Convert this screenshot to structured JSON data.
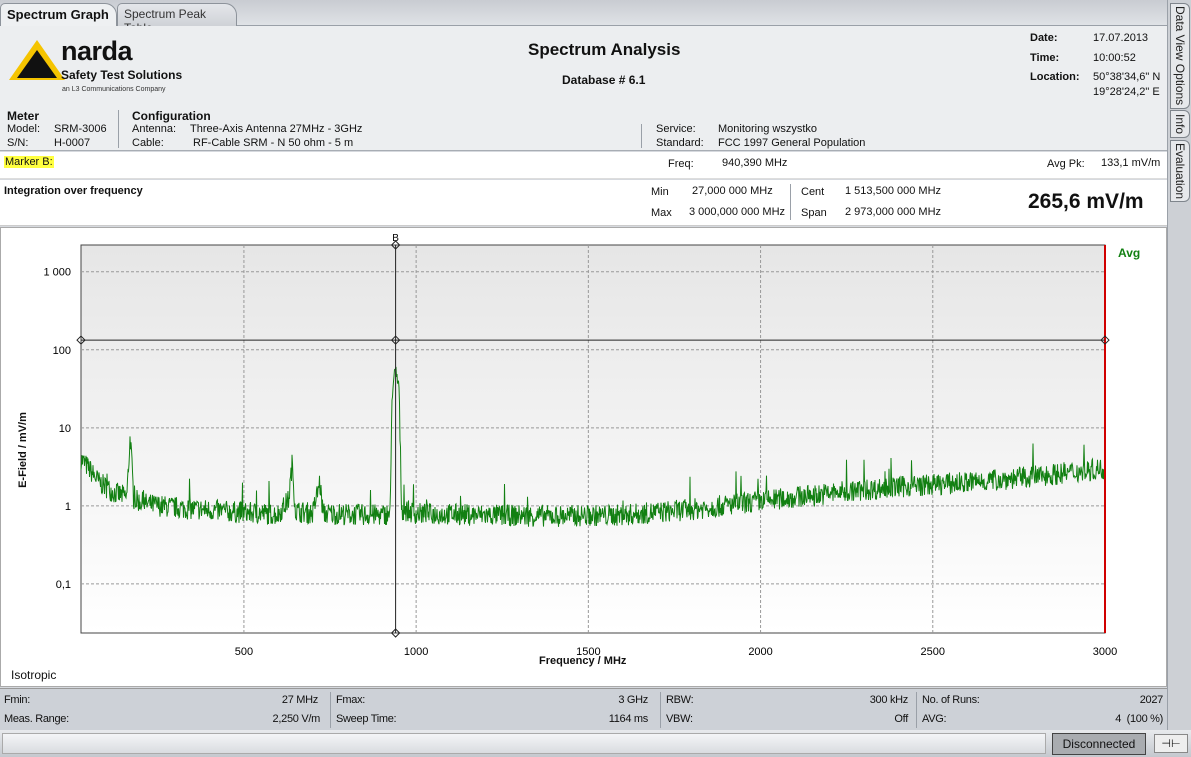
{
  "tabs": [
    {
      "label": "Spectrum Graph",
      "active": true
    },
    {
      "label": "Spectrum Peak Table",
      "active": false
    }
  ],
  "side_tabs": [
    "Data View Options",
    "Info",
    "Evaluation"
  ],
  "logo": {
    "brand": "narda",
    "tagline": "Safety Test Solutions",
    "sub": "an L3 Communications Company",
    "colors": {
      "yellow": "#f5c400",
      "red": "#d8262c"
    }
  },
  "header": {
    "title": "Spectrum Analysis",
    "subtitle": "Database # 6.1",
    "date_label": "Date:",
    "date": "17.07.2013",
    "time_label": "Time:",
    "time": "10:00:52",
    "location_label": "Location:",
    "location_lat": "50°38'34,6\" N",
    "location_lon": "19°28'24,2\" E"
  },
  "meter": {
    "title": "Meter",
    "model_label": "Model:",
    "model": "SRM-3006",
    "sn_label": "S/N:",
    "sn": "H-0007"
  },
  "configuration": {
    "title": "Configuration",
    "antenna_label": "Antenna:",
    "antenna": "Three-Axis Antenna 27MHz - 3GHz",
    "cable_label": "Cable:",
    "cable": "RF-Cable SRM - N 50 ohm - 5 m",
    "service_label": "Service:",
    "service": "Monitoring wszystko",
    "standard_label": "Standard:",
    "standard": "FCC 1997 General Population"
  },
  "marker": {
    "label": "Marker B:",
    "freq_label": "Freq:",
    "freq": "940,390 MHz",
    "avgpk_label": "Avg  Pk:",
    "avgpk": "133,1 mV/m"
  },
  "integration": {
    "title": "Integration over frequency",
    "min_label": "Min",
    "min": "27,000 000 MHz",
    "max_label": "Max",
    "max": "3 000,000 000 MHz",
    "cent_label": "Cent",
    "cent": "1 513,500 000 MHz",
    "span_label": "Span",
    "span": "2 973,000 000 MHz",
    "result": "265,6 mV/m"
  },
  "chart_data": {
    "type": "line",
    "xlabel": "Frequency / MHz",
    "ylabel": "E-Field / mV/m",
    "yscale": "log",
    "xlim": [
      27,
      3000
    ],
    "ylim": [
      0.0235,
      2200
    ],
    "xticks": [
      500,
      1000,
      1500,
      2000,
      2500,
      3000
    ],
    "xtick_labels": [
      "500",
      "1000",
      "1500",
      "2000",
      "2500",
      "3000"
    ],
    "yticks": [
      0.1,
      1,
      10,
      100,
      1000
    ],
    "ytick_labels": [
      "0,1",
      "1",
      "10",
      "100",
      "1 000"
    ],
    "grid": true,
    "series_label": "Avg",
    "series_color": "#128012",
    "limit_color": "#d00000",
    "mode_label": "Isotropic",
    "marker": {
      "name": "B",
      "freq": 940.39,
      "level": 133.1
    },
    "trace": [
      [
        27,
        4
      ],
      [
        50,
        3
      ],
      [
        80,
        2
      ],
      [
        120,
        1.5
      ],
      [
        160,
        1.3
      ],
      [
        170,
        8
      ],
      [
        180,
        1.2
      ],
      [
        220,
        1.05
      ],
      [
        300,
        0.95
      ],
      [
        400,
        0.88
      ],
      [
        500,
        0.82
      ],
      [
        600,
        0.78
      ],
      [
        630,
        1.2
      ],
      [
        640,
        3.5
      ],
      [
        650,
        0.85
      ],
      [
        700,
        0.8
      ],
      [
        720,
        2
      ],
      [
        730,
        0.8
      ],
      [
        800,
        0.78
      ],
      [
        900,
        0.76
      ],
      [
        925,
        0.8
      ],
      [
        930,
        30
      ],
      [
        940,
        50
      ],
      [
        950,
        35
      ],
      [
        958,
        0.9
      ],
      [
        1000,
        0.8
      ],
      [
        1200,
        0.76
      ],
      [
        1400,
        0.74
      ],
      [
        1600,
        0.76
      ],
      [
        1800,
        0.9
      ],
      [
        2000,
        1.15
      ],
      [
        2200,
        1.45
      ],
      [
        2400,
        1.75
      ],
      [
        2600,
        2.0
      ],
      [
        2800,
        2.4
      ],
      [
        3000,
        3
      ]
    ]
  },
  "info": {
    "fmin_label": "Fmin:",
    "fmin": "27 MHz",
    "range_label": "Meas. Range:",
    "range": "2,250 V/m",
    "fmax_label": "Fmax:",
    "fmax": "3 GHz",
    "sweep_label": "Sweep Time:",
    "sweep": "1164 ms",
    "rbw_label": "RBW:",
    "rbw": "300 kHz",
    "vbw_label": "VBW:",
    "vbw": "Off",
    "runs_label": "No. of Runs:",
    "runs": "2027",
    "avg_label": "AVG:",
    "avg": "4  (100 %)"
  },
  "status": {
    "connection": "Disconnected"
  }
}
